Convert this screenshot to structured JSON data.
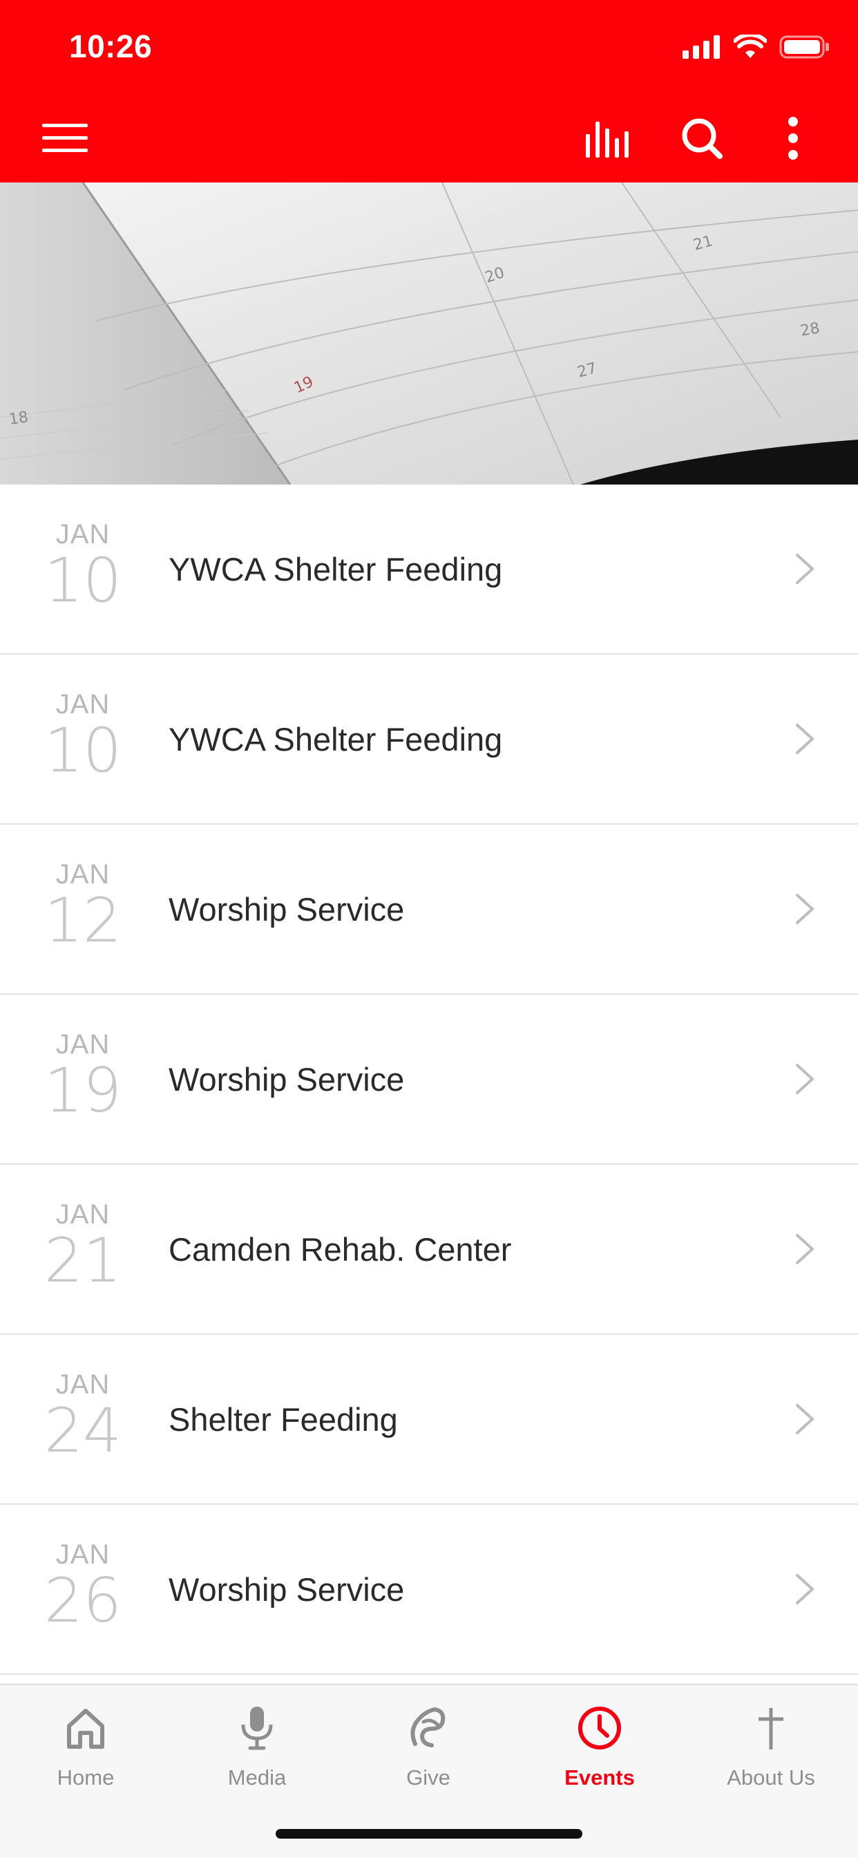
{
  "status_bar": {
    "time": "10:26"
  },
  "colors": {
    "brand": "#fd0008",
    "active_tab": "#f00012",
    "inactive_tab": "#8e8e8e"
  },
  "toolbar": {
    "menu_icon": "hamburger-menu-icon",
    "actions": [
      "equalizer-icon",
      "search-icon",
      "more-vertical-icon"
    ]
  },
  "hero": {
    "image": "calendar-photo",
    "visible_numbers": [
      "18",
      "19",
      "20",
      "21",
      "27",
      "28"
    ]
  },
  "events": [
    {
      "month": "JAN",
      "day": "10",
      "title": "YWCA Shelter Feeding"
    },
    {
      "month": "JAN",
      "day": "10",
      "title": "YWCA Shelter Feeding"
    },
    {
      "month": "JAN",
      "day": "12",
      "title": "Worship Service"
    },
    {
      "month": "JAN",
      "day": "19",
      "title": "Worship Service"
    },
    {
      "month": "JAN",
      "day": "21",
      "title": "Camden Rehab. Center"
    },
    {
      "month": "JAN",
      "day": "24",
      "title": "Shelter Feeding"
    },
    {
      "month": "JAN",
      "day": "26",
      "title": "Worship Service"
    }
  ],
  "tabs": [
    {
      "label": "Home",
      "icon": "home-icon",
      "active": false
    },
    {
      "label": "Media",
      "icon": "microphone-icon",
      "active": false
    },
    {
      "label": "Give",
      "icon": "give-icon",
      "active": false
    },
    {
      "label": "Events",
      "icon": "clock-icon",
      "active": true
    },
    {
      "label": "About Us",
      "icon": "cross-icon",
      "active": false
    }
  ]
}
